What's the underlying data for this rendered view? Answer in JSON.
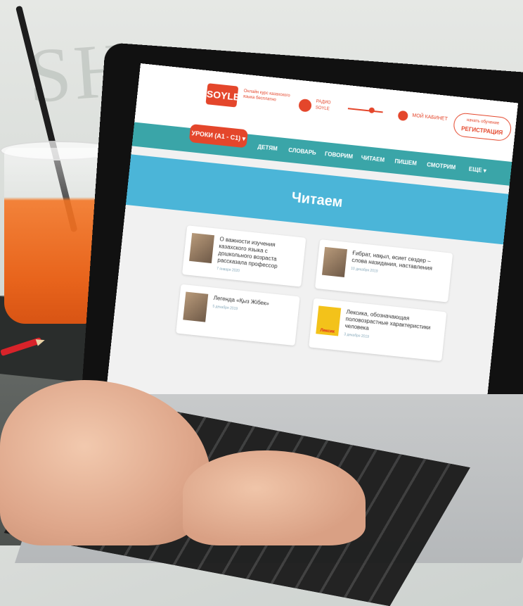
{
  "site": {
    "logo": "SOYLE",
    "tagline": "Онлайн курс казахского языка бесплатно",
    "radio": "РАДИО SOYLE",
    "cabinet": "МОЙ КАБИНЕТ",
    "register_top": "начать обучение",
    "register": "РЕГИСТРАЦИЯ"
  },
  "nav": {
    "lessons": "УРОКИ (A1 - C1) ▾",
    "items": [
      "ДЕТЯМ",
      "СЛОВАРЬ",
      "ГОВОРИМ",
      "ЧИТАЕМ",
      "ПИШЕМ",
      "СМОТРИМ",
      "ЕЩЕ ▾"
    ]
  },
  "banner": {
    "title": "Читаем"
  },
  "cards": [
    {
      "title": "О важности изучения казахского языка с дошкольного возраста рассказала профессор",
      "date": "7 января 2020"
    },
    {
      "title": "Ғибрат, нақыл, өсиет сөздер – слова назидания, наставления",
      "date": "10 декабря 2019"
    },
    {
      "title": "Легенда «Қыз Жібек»",
      "date": "5 декабря 2019"
    },
    {
      "title": "Лексика, обозначающая половозрастные характеристики человека",
      "date": "3 декабря 2019",
      "thumb": "Лексик"
    }
  ],
  "colors": {
    "brand": "#e4462b",
    "teal": "#3aa5a8",
    "banner": "#4bb5d8"
  }
}
